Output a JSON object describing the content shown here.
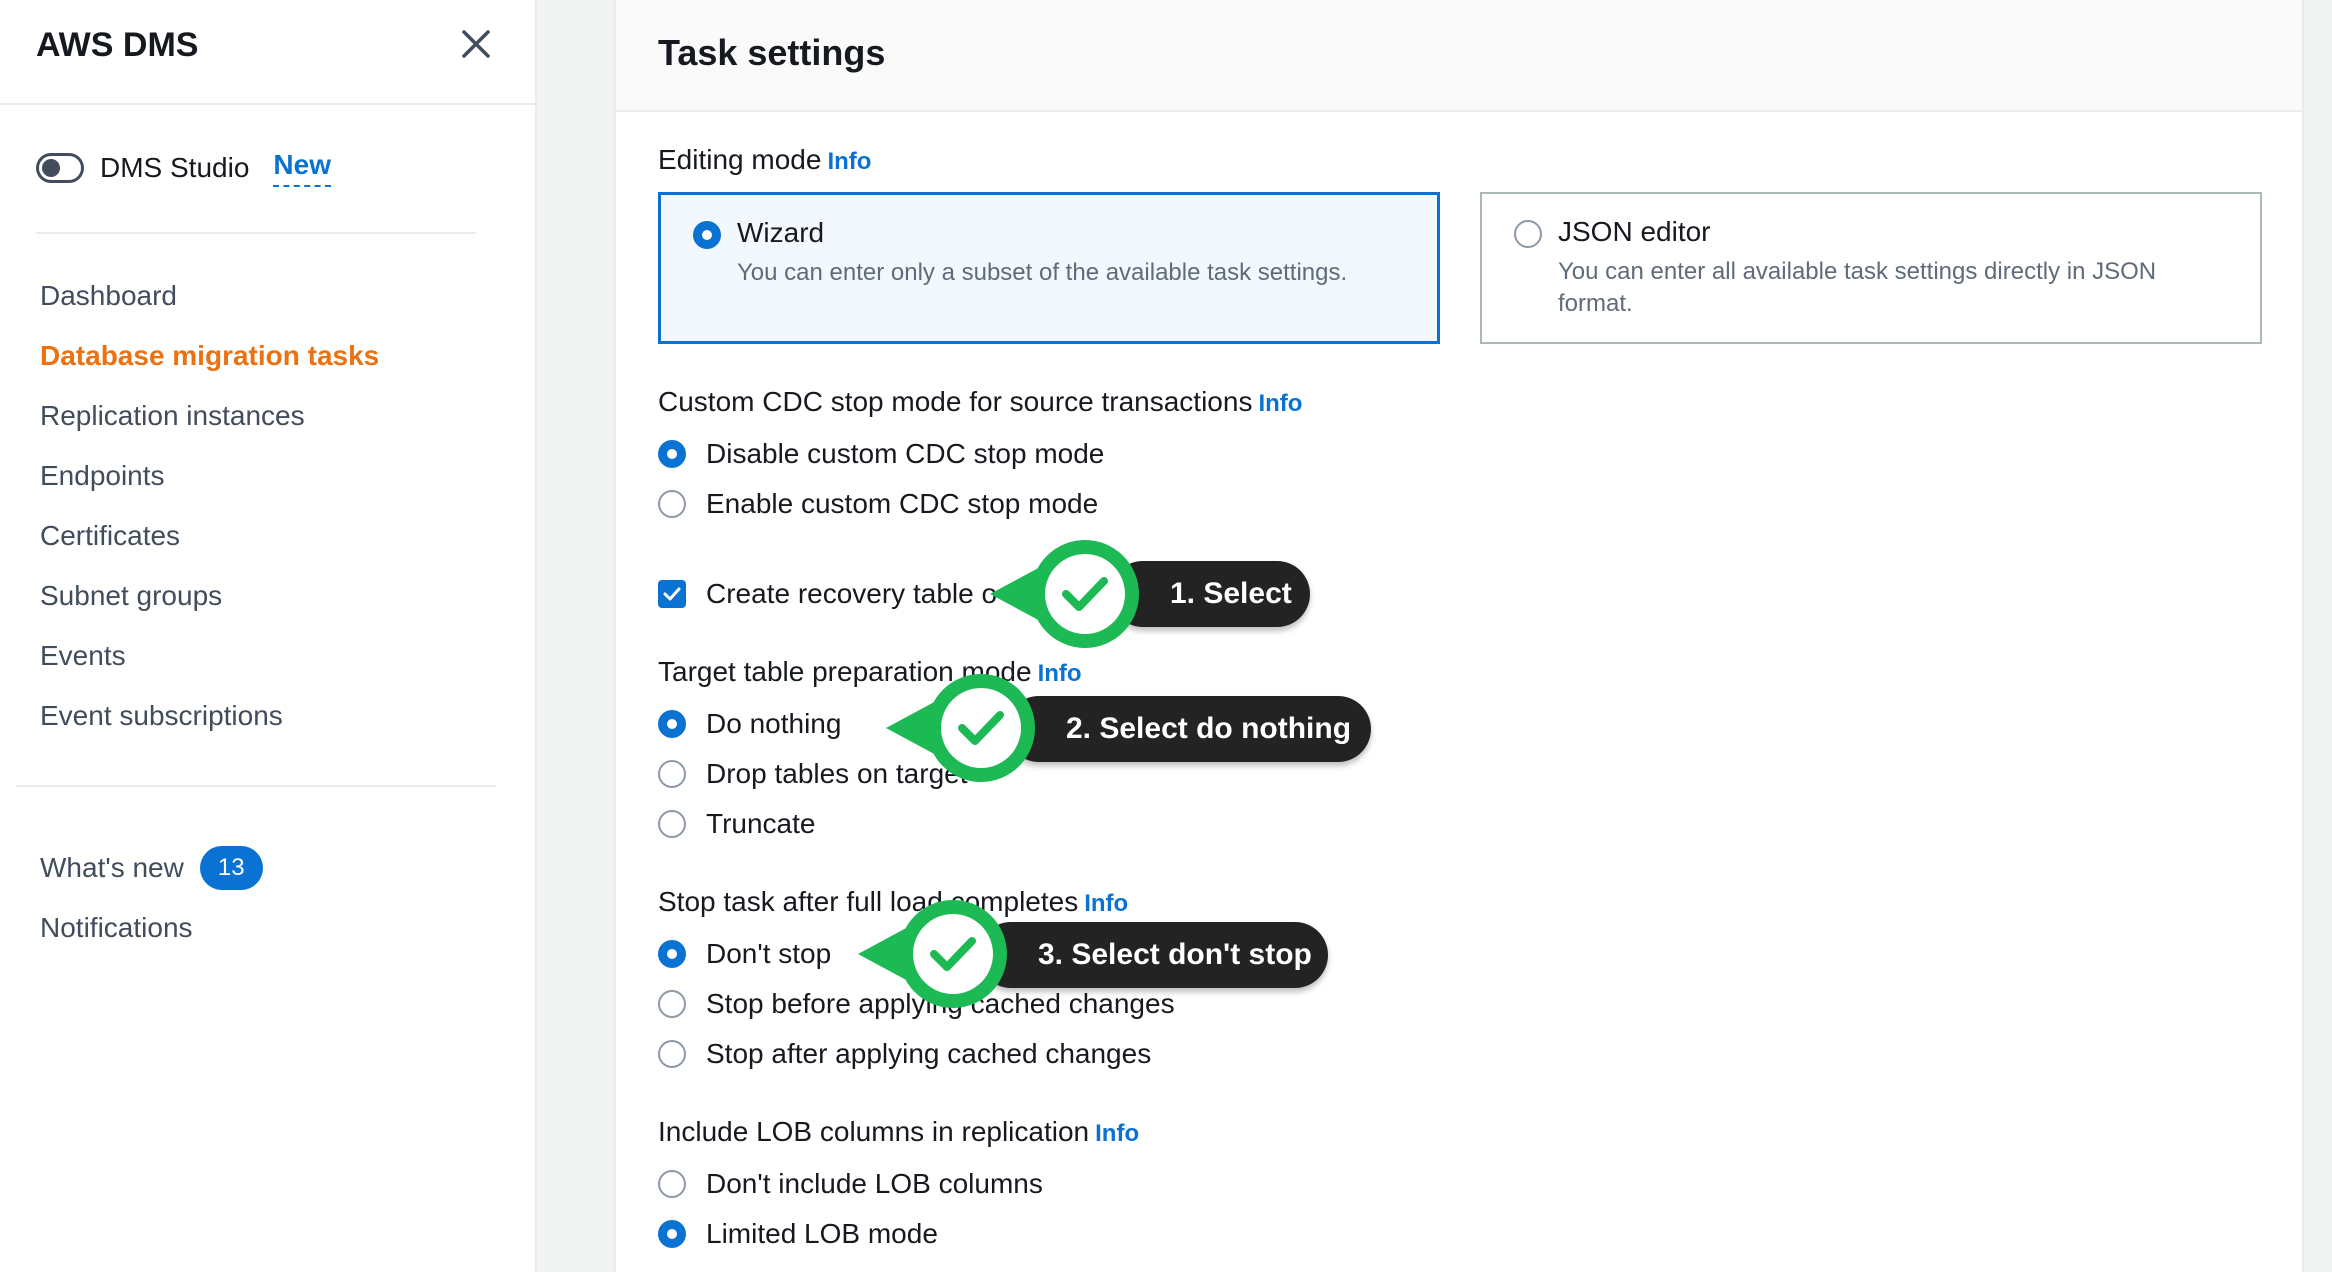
{
  "sidebar": {
    "title": "AWS DMS",
    "studio": {
      "label": "DMS Studio",
      "new": "New"
    },
    "nav": [
      {
        "label": "Dashboard",
        "active": false
      },
      {
        "label": "Database migration tasks",
        "active": true
      },
      {
        "label": "Replication instances",
        "active": false
      },
      {
        "label": "Endpoints",
        "active": false
      },
      {
        "label": "Certificates",
        "active": false
      },
      {
        "label": "Subnet groups",
        "active": false
      },
      {
        "label": "Events",
        "active": false
      },
      {
        "label": "Event subscriptions",
        "active": false
      }
    ],
    "whats_new": {
      "label": "What's new",
      "count": "13"
    },
    "notifications": "Notifications"
  },
  "panel": {
    "title": "Task settings",
    "info": "Info",
    "editing_mode": {
      "label": "Editing mode",
      "wizard": {
        "title": "Wizard",
        "desc": "You can enter only a subset of the available task settings.",
        "selected": true
      },
      "json": {
        "title": "JSON editor",
        "desc": "You can enter all available task settings directly in JSON format.",
        "selected": false
      }
    },
    "cdc": {
      "label": "Custom CDC stop mode for source transactions",
      "options": [
        "Disable custom CDC stop mode",
        "Enable custom CDC stop mode"
      ],
      "selected": 0
    },
    "recovery": {
      "label": "Create recovery table o",
      "checked": true
    },
    "prep": {
      "label": "Target table preparation mode",
      "options": [
        "Do nothing",
        "Drop tables on target",
        "Truncate"
      ],
      "selected": 0
    },
    "stop": {
      "label": "Stop task after full load completes",
      "options": [
        "Don't stop",
        "Stop before applying cached changes",
        "Stop after applying cached changes"
      ],
      "selected": 0
    },
    "lob": {
      "label": "Include LOB columns in replication",
      "options": [
        "Don't include LOB columns",
        "Limited LOB mode"
      ],
      "selected": 1
    }
  },
  "callouts": [
    {
      "text": "1. Select"
    },
    {
      "text": "2. Select  do nothing"
    },
    {
      "text": "3. Select don't stop"
    }
  ],
  "colors": {
    "accent": "#0972d3",
    "active_nav": "#ec7211",
    "callout_green": "#1db954",
    "callout_dark": "#232323"
  }
}
